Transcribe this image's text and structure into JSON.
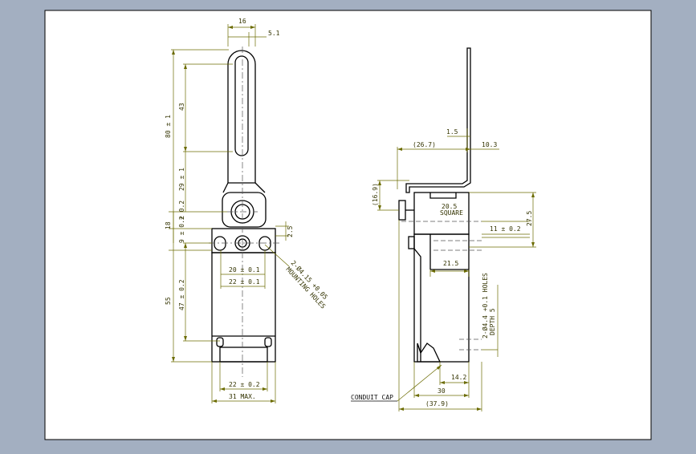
{
  "colors": {
    "background": "#a3afc1",
    "sheet": "#ffffff",
    "geometry": "#000000",
    "dimension": "#6b6b00",
    "centerline": "#555555"
  },
  "front_view": {
    "dims": {
      "top_width": "16",
      "top_offset": "5.1",
      "height_80": "80 ± 1",
      "slot_43": "43",
      "d_29": "29 ± 1",
      "d_18": "18",
      "tol_02": "± 0.2",
      "d_9": "9 ± 0.2",
      "d_2_5": "2.5",
      "d_55": "55",
      "d_47": "47 ± 0.2",
      "width_20": "20 ± 0.1",
      "width_22_top": "22 ± 0.1",
      "width_22_bottom": "22 ± 0.2",
      "width_31": "31 MAX."
    },
    "mounting_note": [
      "2-Ø4.15 +0.05",
      "MOUNTING HOLES"
    ]
  },
  "side_view": {
    "dims": {
      "d_26_7": "(26.7)",
      "d_1_5": "1.5",
      "d_10_3": "10.3",
      "d_16_9": "(16.9)",
      "square_value": "20.5",
      "square_label": "SQUARE",
      "d_11": "11 ± 0.2",
      "d_27_5": "27.5",
      "d_21_5": "21.5",
      "d_14_2": "14.2",
      "d_30": "30",
      "d_37_9": "(37.9)"
    },
    "holes_note": [
      "2-Ø4.4 +0.1 HOLES",
      "DEPTH 5"
    ],
    "conduit_label": "CONDUIT CAP"
  }
}
